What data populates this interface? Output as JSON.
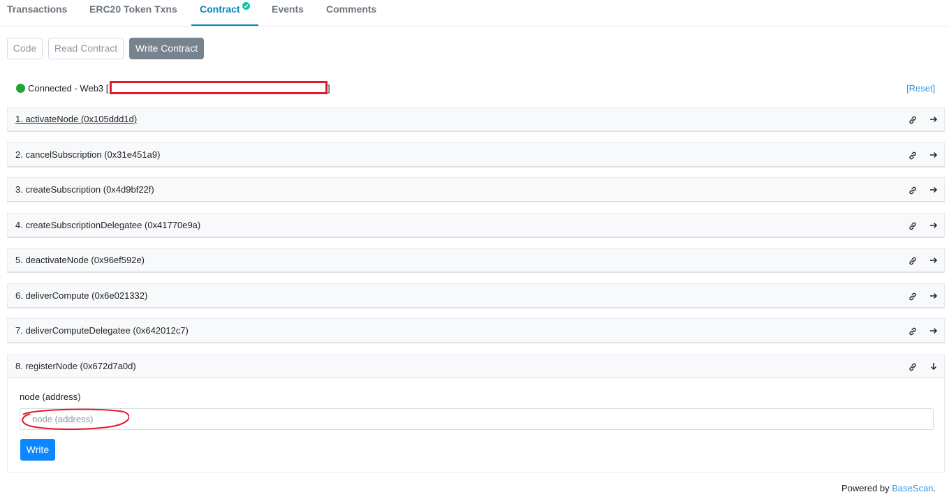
{
  "tabs": [
    {
      "label": "Transactions"
    },
    {
      "label": "ERC20 Token Txns"
    },
    {
      "label": "Contract"
    },
    {
      "label": "Events"
    },
    {
      "label": "Comments"
    }
  ],
  "contract_tabs": {
    "code": "Code",
    "read": "Read Contract",
    "write": "Write Contract"
  },
  "connection": {
    "status": "Connected - Web3 [",
    "bracket_close": "]",
    "reset": "[Reset]",
    "status_color": "#21a336"
  },
  "functions": [
    {
      "label": "1. activateNode (0x105ddd1d)"
    },
    {
      "label": "2. cancelSubscription (0x31e451a9)"
    },
    {
      "label": "3. createSubscription (0x4d9bf22f)"
    },
    {
      "label": "4. createSubscriptionDelegatee (0x41770e9a)"
    },
    {
      "label": "5. deactivateNode (0x96ef592e)"
    },
    {
      "label": "6. deliverCompute (0x6e021332)"
    },
    {
      "label": "7. deliverComputeDelegatee (0x642012c7)"
    },
    {
      "label": "8. registerNode (0x672d7a0d)"
    }
  ],
  "register_form": {
    "field_label": "node (address)",
    "placeholder": "node (address)",
    "value": "",
    "submit": "Write"
  },
  "footer": {
    "prefix": "Powered by ",
    "brand": "BaseScan",
    "suffix": "."
  },
  "colors": {
    "accent": "#0784c3",
    "write_button": "#0d87ff",
    "annotation_red": "#e11b2b"
  }
}
